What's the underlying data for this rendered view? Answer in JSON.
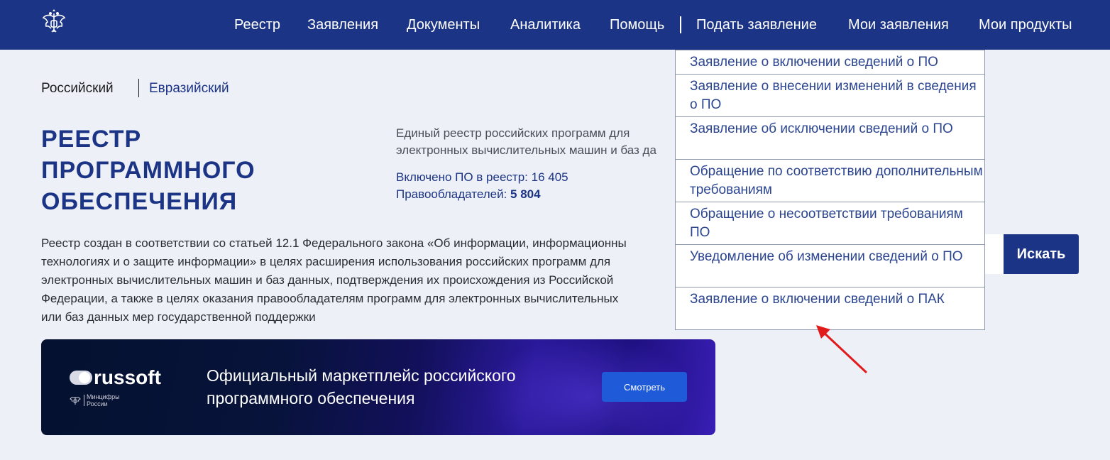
{
  "header": {
    "logo_icon": "coat-of-arms-icon",
    "nav_left": [
      "Реестр",
      "Заявления",
      "Документы",
      "Аналитика",
      "Помощь"
    ],
    "nav_right": [
      "Подать заявление",
      "Мои заявления",
      "Мои продукты"
    ]
  },
  "dropdown": {
    "items": [
      "Заявление о включении сведений о ПО",
      "Заявление о внесении изменений в сведения о ПО",
      "Заявление об исключении сведений о ПО",
      "Обращение по соответствию дополнительным требованиям",
      "Обращение о несоответствии требованиям ПО",
      "Уведомление об изменении сведений о ПО",
      "Заявление о включении сведений о ПАК"
    ]
  },
  "tabs": {
    "russian": "Российский",
    "eurasian": "Евразийский"
  },
  "page_title": "РЕЕСТР ПРОГРАММНОГО ОБЕСПЕЧЕНИЯ",
  "info": {
    "description_line1": "Единый реестр российских программ для",
    "description_line2": "электронных вычислительных машин и баз да",
    "included_label": "Включено ПО в реестр: 16 405",
    "holders_label": "Правообладателей:",
    "holders_value": "5 804"
  },
  "paragraph": {
    "line1": "Реестр создан в соответствии со статьей 12.1 Федерального закона «Об информации, информационны",
    "line2": "технологиях и о защите информации» в целях расширения использования российских программ для",
    "line3": "электронных вычислительных машин и баз данных, подтверждения их происхождения из Российской",
    "line4": "Федерации, а также в целях оказания правообладателям программ для электронных вычислительных",
    "line5": "или баз данных мер государственной поддержки"
  },
  "search": {
    "value": "",
    "button_label": "Искать"
  },
  "banner": {
    "brand": "russoft",
    "ministry": "Минцифры России",
    "ministry_line1": "Минцифры",
    "ministry_line2": "России",
    "title": "Официальный маркетплейс российского программного обеспечения",
    "button_label": "Смотреть"
  },
  "colors": {
    "header_bg": "#1c3485",
    "page_bg": "#edf0f6",
    "dropdown_text": "#2b4590",
    "annotation_arrow": "#e11b1b",
    "banner_button": "#1f5bd8"
  }
}
